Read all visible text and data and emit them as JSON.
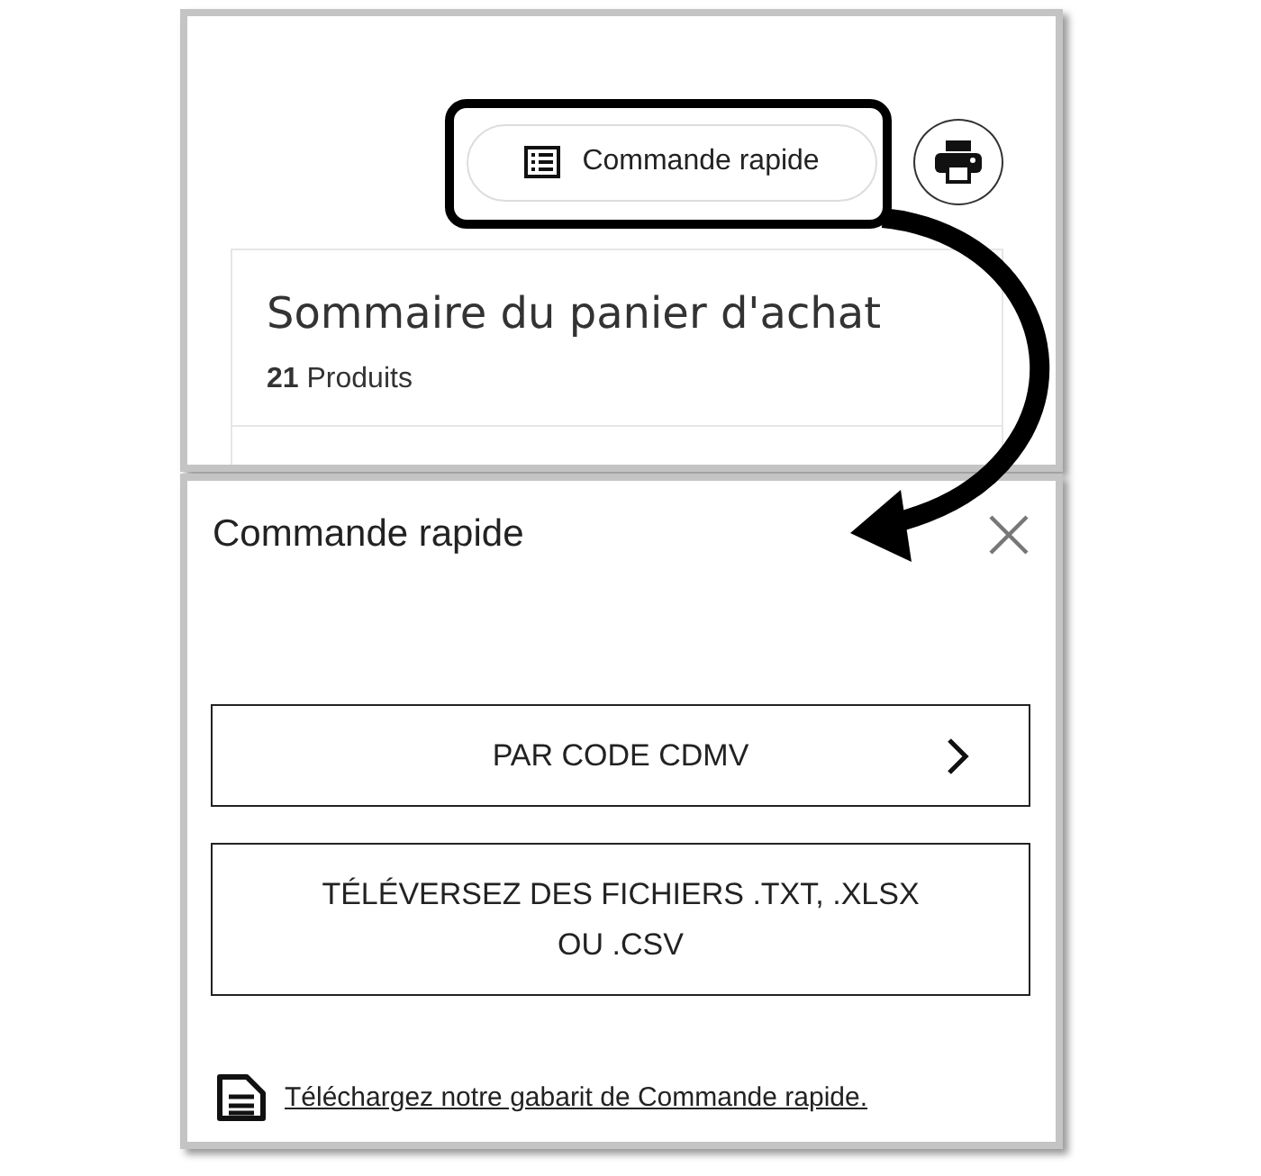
{
  "toolbar": {
    "quick_order_button": {
      "label": "Commande rapide"
    }
  },
  "cart_summary": {
    "title": "Sommaire du panier d'achat",
    "count": "**21** Produits"
  },
  "quick_order_dialog": {
    "title": "Commande rapide",
    "options": [
      {
        "label": "PAR CODE CDMV",
        "kind": "chevron"
      },
      {
        "label": "TÉLÉVERSEZ DES FICHIERS .TXT, .XLSX OU .CSV",
        "kind": "plain"
      }
    ],
    "template_link": "Téléchargez notre gabarit de Commande rapide."
  }
}
